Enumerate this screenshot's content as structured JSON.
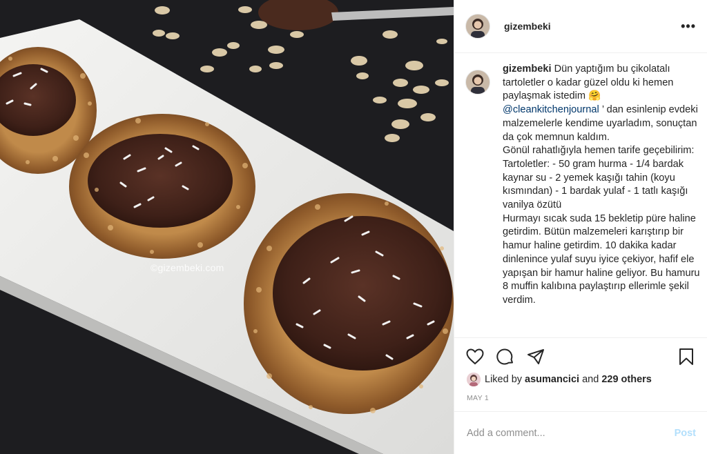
{
  "photo": {
    "watermark": "©gizembeki.com"
  },
  "post": {
    "username": "gizembeki",
    "more_label": "•••",
    "caption": {
      "username": "gizembeki",
      "line1": " Dün yaptığım bu çikolatalı tartoletler o kadar güzel oldu ki hemen paylaşmak istedim 🤗",
      "mention": "@cleankitchenjournal",
      "line2": " ’ dan esinlenip evdeki malzemelerle kendime uyarladım, sonuçtan da çok memnun kaldım.",
      "line3": "Gönül rahatlığıyla hemen tarife geçebilirim:",
      "line4": "Tartoletler: - 50 gram hurma - 1/4 bardak kaynar su - 2 yemek kaşığı tahin (koyu kısmından) - 1 bardak yulaf - 1 tatlı kaşığı vanilya özütü",
      "line5": "Hurmayı sıcak suda 15 bekletip püre haline getirdim. Bütün malzemeleri karıştırıp bir hamur haline getirdim. 10 dakika kadar dinlenince yulaf suyu iyice çekiyor, hafif ele yapışan bir hamur haline geliyor. Bu hamuru 8 muffin kalıbına paylaştırıp ellerimle şekil verdim."
    },
    "likes": {
      "prefix": "Liked by ",
      "user": "asumancici",
      "mid": " and ",
      "count": "229 others"
    },
    "date": "MAY 1",
    "comment": {
      "placeholder": "Add a comment...",
      "post_label": "Post"
    }
  },
  "icons": [
    "heart-icon",
    "comment-icon",
    "share-icon",
    "bookmark-icon"
  ],
  "colors": {
    "post_button": "#b2dffc",
    "mention": "#00376b",
    "muted": "#8e8e8e"
  }
}
